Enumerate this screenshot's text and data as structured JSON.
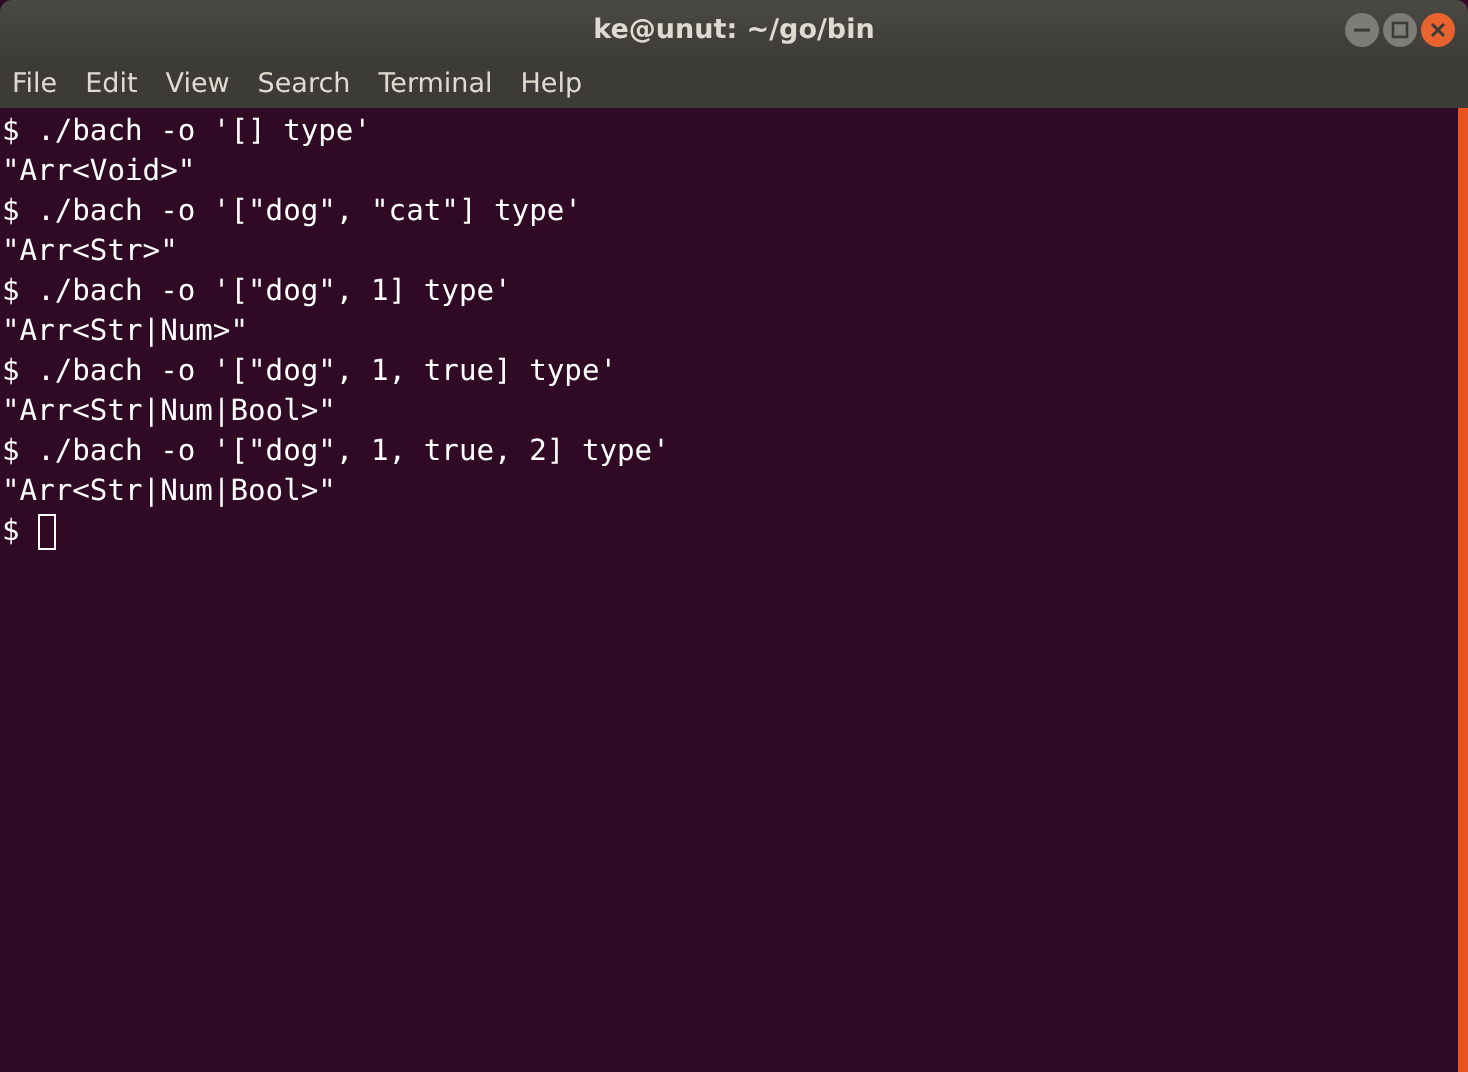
{
  "window": {
    "title": "ke@unut: ~/go/bin"
  },
  "menu": [
    "File",
    "Edit",
    "View",
    "Search",
    "Terminal",
    "Help"
  ],
  "lines": [
    {
      "kind": "command",
      "text": "$ ./bach -o '[] type'"
    },
    {
      "kind": "output",
      "text": "\"Arr<Void>\""
    },
    {
      "kind": "command",
      "text": "$ ./bach -o '[\"dog\", \"cat\"] type'"
    },
    {
      "kind": "output",
      "text": "\"Arr<Str>\""
    },
    {
      "kind": "command",
      "text": "$ ./bach -o '[\"dog\", 1] type'"
    },
    {
      "kind": "output",
      "text": "\"Arr<Str|Num>\""
    },
    {
      "kind": "command",
      "text": "$ ./bach -o '[\"dog\", 1, true] type'"
    },
    {
      "kind": "output",
      "text": "\"Arr<Str|Num|Bool>\""
    },
    {
      "kind": "command",
      "text": "$ ./bach -o '[\"dog\", 1, true, 2] type'"
    },
    {
      "kind": "output",
      "text": "\"Arr<Str|Num|Bool>\""
    },
    {
      "kind": "prompt",
      "text": "$"
    }
  ]
}
